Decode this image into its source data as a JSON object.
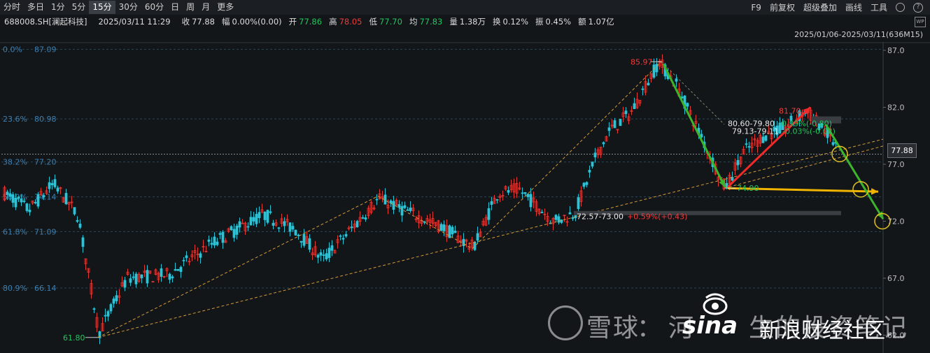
{
  "toolbar": {
    "periods": [
      "分时",
      "多日",
      "1分",
      "5分",
      "15分",
      "30分",
      "60分",
      "日",
      "周",
      "月",
      "更多"
    ],
    "active_period": "15分",
    "tools": [
      "F9",
      "前复权",
      "超级叠加",
      "画线",
      "工具"
    ],
    "help_glyph": "?"
  },
  "info": {
    "code": "688008.SH[澜起科技]",
    "datetime": "2025/03/11 11:29",
    "close_label": "收",
    "close": "77.88",
    "amp_label": "幅",
    "amp": "0.00%(0.00)",
    "open_label": "开",
    "open": "77.86",
    "high_label": "高",
    "high": "78.05",
    "low_label": "低",
    "low": "77.70",
    "avg_label": "均",
    "avg": "77.83",
    "vol_label": "量",
    "vol": "1.38万",
    "turn_label": "换",
    "turn": "0.12%",
    "swing_label": "振",
    "swing": "0.45%",
    "amount_label": "额",
    "amount": "1.07亿",
    "wp_badge": "WP"
  },
  "range": "2025/01/06-2025/03/11(636M15)",
  "y_axis": [
    "87.0",
    "82.0",
    "77.0",
    "72.0",
    "67.0",
    "62.0"
  ],
  "current_price": "77.88",
  "fib_levels": [
    {
      "pct": "0.0%",
      "price": "87.09"
    },
    {
      "pct": "23.6%",
      "price": "80.98"
    },
    {
      "pct": "38.2%",
      "price": "77.20"
    },
    {
      "pct": "50.0%",
      "price": "74.14"
    },
    {
      "pct": "61.8%",
      "price": "71.09"
    },
    {
      "pct": "80.9%",
      "price": "66.14"
    }
  ],
  "annotations": {
    "high_peak": "85.97",
    "low_start": "61.80",
    "low_mid": "74.90",
    "peak2": "81.70",
    "box_range": "72.57-73.00",
    "box_change": "+0.59%(+0.43)",
    "range1": "80.60-79.80",
    "change1": "-0.99%(-0.80)",
    "range2": "79.13-79.11",
    "change2": "-0.03%(-0.02)"
  },
  "colors": {
    "up": "#e53935",
    "down": "#26c6da",
    "green_arrow": "#3cb52c",
    "red_arrow": "#ee2a2a",
    "yellow_arrow": "#f0b400",
    "trend_line": "#d39a3a",
    "fib_line": "#2d4656"
  },
  "watermark": {
    "brand": "雪球",
    "sep": "：",
    "author": "河",
    "tail": "生的投资笔记"
  },
  "sina": {
    "logo": "sina",
    "name": "新浪财经社区"
  }
}
